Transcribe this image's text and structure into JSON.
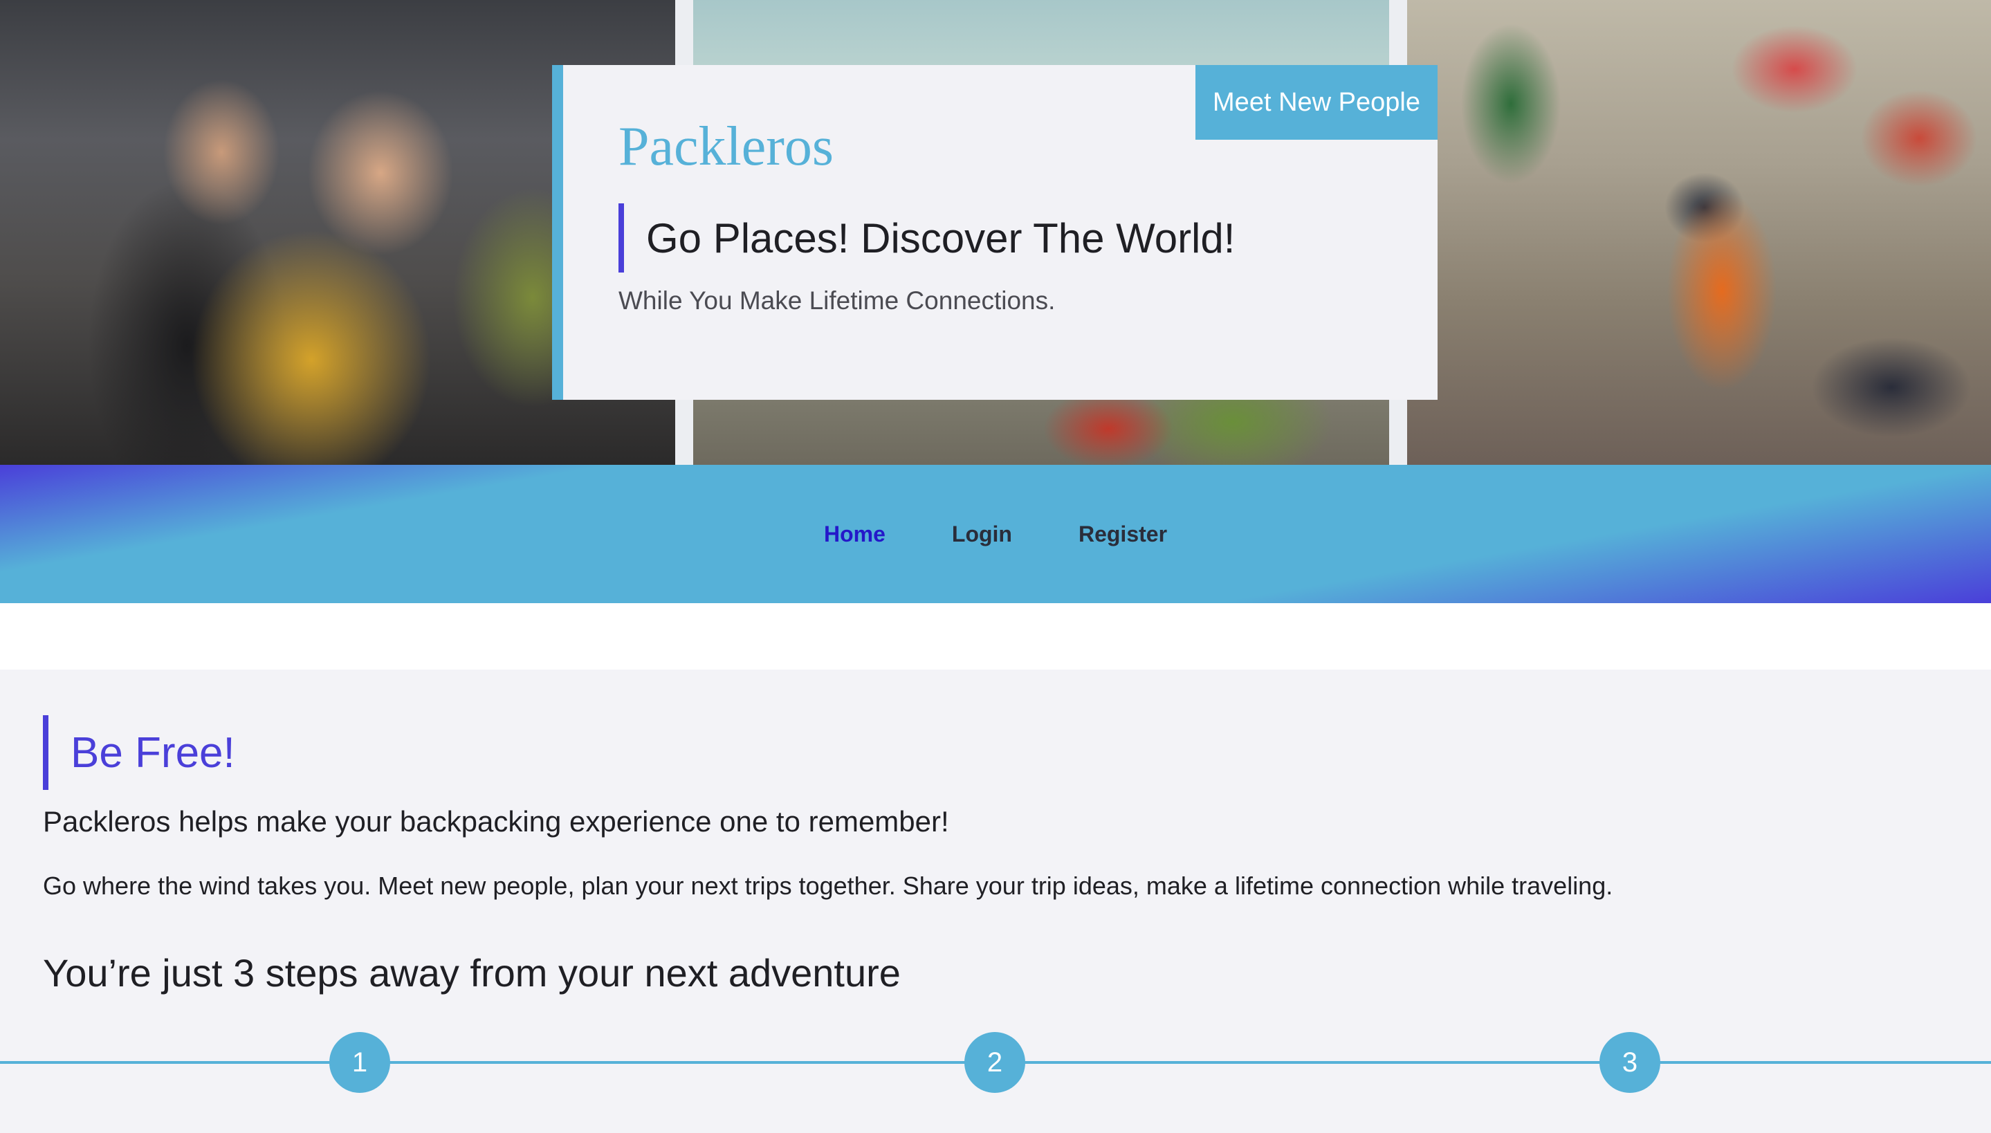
{
  "hero": {
    "badge": "Meet New People",
    "brand": "Packleros",
    "tagline": "Go Places! Discover The World!",
    "subtagline": "While You Make Lifetime Connections."
  },
  "nav": {
    "items": [
      {
        "label": "Home",
        "active": true
      },
      {
        "label": "Login",
        "active": false
      },
      {
        "label": "Register",
        "active": false
      }
    ]
  },
  "content": {
    "title": "Be Free!",
    "lead": "Packleros helps make your backpacking experience one to remember!",
    "body": "Go where the wind takes you. Meet new people, plan your next trips together. Share your trip ideas, make a lifetime connection while traveling.",
    "steps_heading": "You’re just 3 steps away from your next adventure",
    "steps": [
      {
        "number": "1"
      },
      {
        "number": "2"
      },
      {
        "number": "3"
      }
    ]
  },
  "colors": {
    "accent_blue": "#56b1d8",
    "accent_purple": "#4a3fd9",
    "nav_active": "#2418c9"
  }
}
